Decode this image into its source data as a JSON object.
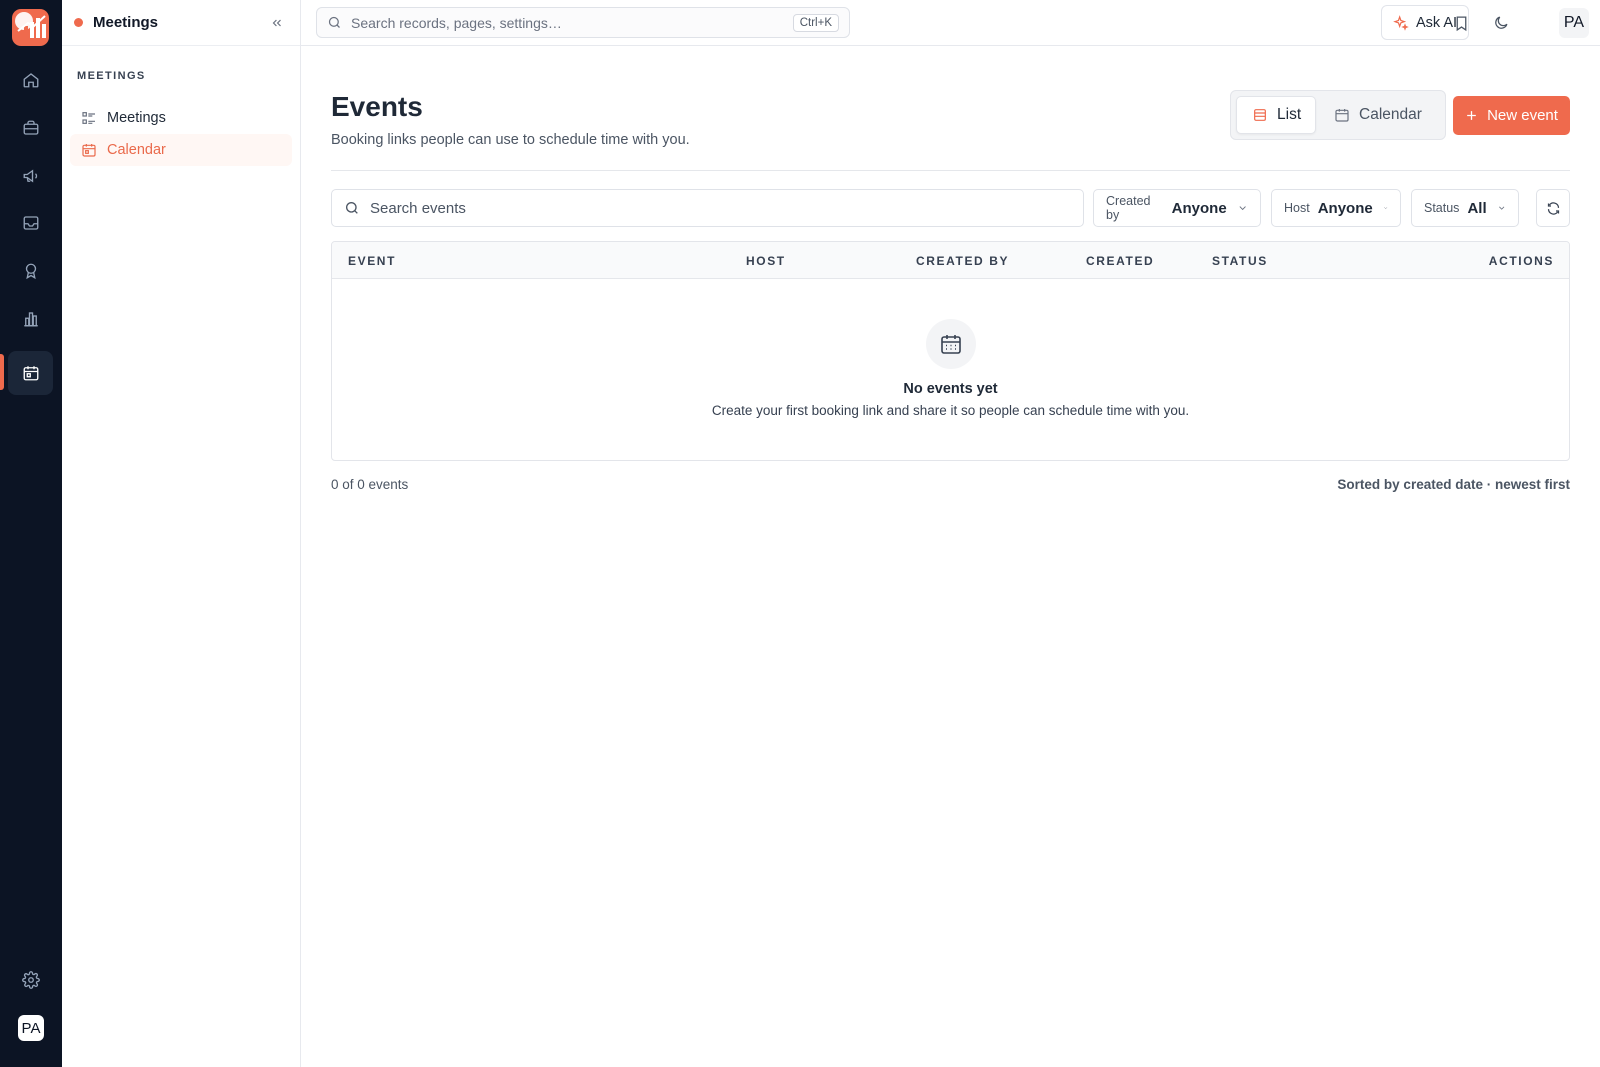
{
  "colors": {
    "accent": "#ef6a4d",
    "rail": "#0c1424"
  },
  "rail": {
    "items": [
      {
        "icon": "home-icon"
      },
      {
        "icon": "briefcase-icon"
      },
      {
        "icon": "megaphone-icon"
      },
      {
        "icon": "inbox-icon"
      },
      {
        "icon": "award-icon"
      },
      {
        "icon": "bar-chart-icon"
      },
      {
        "icon": "calendar-icon",
        "active": true
      }
    ],
    "settings_icon": "gear-icon",
    "avatar": "PA"
  },
  "sidebar": {
    "title": "Meetings",
    "section": "MEETINGS",
    "items": [
      {
        "label": "Meetings",
        "icon": "list-icon"
      },
      {
        "label": "Calendar",
        "icon": "calendar-icon",
        "active": true
      }
    ]
  },
  "topbar": {
    "search_placeholder": "Search records, pages, settings…",
    "shortcut": "Ctrl+K",
    "ask_ai": "Ask AI",
    "avatar": "PA"
  },
  "page": {
    "title": "Events",
    "subtitle": "Booking links people can use to schedule time with you.",
    "view_list": "List",
    "view_calendar": "Calendar",
    "new_event": "+ New event",
    "new_event_label": "New event",
    "search_placeholder": "Search events",
    "filters": [
      {
        "label": "Created by",
        "value": "Anyone"
      },
      {
        "label": "Host",
        "value": "Anyone"
      },
      {
        "label": "Status",
        "value": "All"
      }
    ],
    "columns": [
      "EVENT",
      "HOST",
      "CREATED BY",
      "CREATED",
      "STATUS",
      "ACTIONS"
    ],
    "empty_title": "No events yet",
    "empty_desc": "Create your first booking link and share it so people can schedule time with you.",
    "count": "0 of 0 events",
    "sort": "Sorted by created date · newest first"
  }
}
